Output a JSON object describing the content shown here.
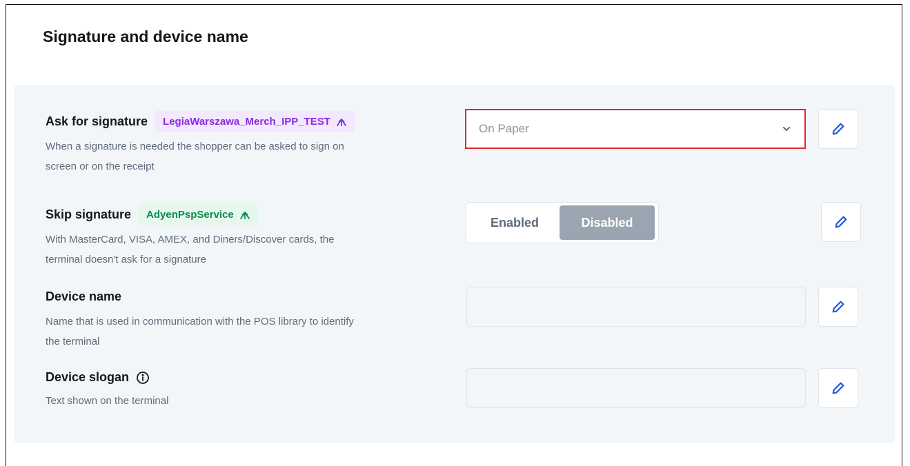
{
  "section": {
    "title": "Signature and device name"
  },
  "rows": [
    {
      "label": "Ask for signature",
      "tag": "LegiaWarszawa_Merch_IPP_TEST",
      "tag_color": "#8a2be2",
      "description_lines": [
        "When a signature is needed the shopper can be asked to sign on",
        "screen or on the receipt"
      ],
      "control": {
        "type": "select",
        "value": "On Paper"
      }
    },
    {
      "label": "Skip signature",
      "tag": "AdyenPspService",
      "tag_color": "#0c8a4c",
      "description_lines": [
        "With MasterCard, VISA, AMEX, and Diners/Discover cards, the",
        "terminal doesn't ask for a signature"
      ],
      "control": {
        "type": "toggle",
        "options": [
          "Enabled",
          "Disabled"
        ],
        "selected": "Disabled"
      }
    },
    {
      "label": "Device name",
      "description_lines": [
        "Name that is used in communication with the POS library to identify",
        "the terminal"
      ],
      "control": {
        "type": "text",
        "value": ""
      }
    },
    {
      "label": "Device slogan",
      "info_icon": "info-circle-icon",
      "description_lines": [
        "Text shown on the terminal"
      ],
      "control": {
        "type": "text",
        "value": ""
      }
    }
  ],
  "icons": {
    "edit": "pencil-icon",
    "inheritance": "merge-arrow-icon",
    "dropdown": "chevron-down-icon"
  },
  "colors": {
    "highlight_border": "#e2242c",
    "edit_icon": "#1e5bd7",
    "panel_bg": "#f3f6f9"
  }
}
